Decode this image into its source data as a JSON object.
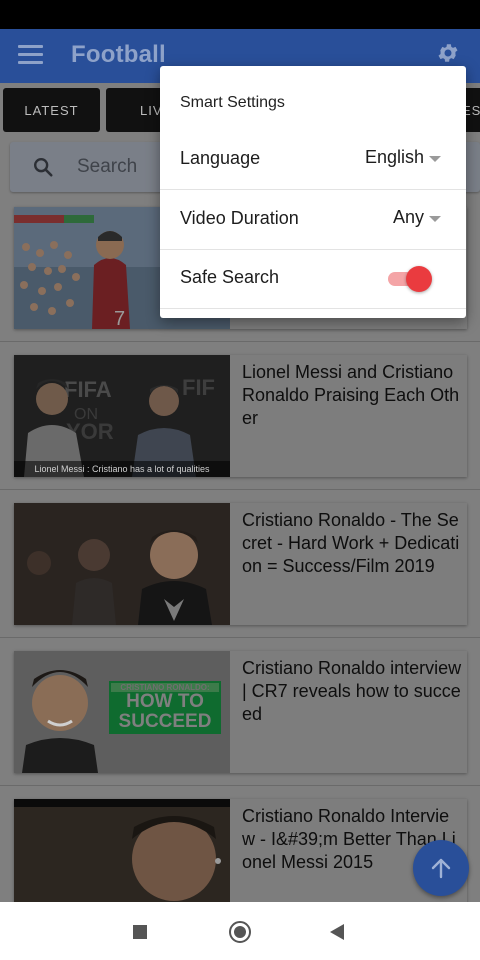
{
  "app_bar": {
    "title": "Football"
  },
  "tabs": [
    {
      "label": "LATEST"
    },
    {
      "label": "LIV"
    },
    {
      "label": "ES"
    }
  ],
  "search": {
    "placeholder": "Search"
  },
  "videos": [
    {
      "title": ""
    },
    {
      "title": "Lionel Messi and Cristiano Ronaldo Praising Each Other",
      "thumb_caption": "Lionel Messi : Cristiano has a lot of qualities"
    },
    {
      "title": "Cristiano Ronaldo - The Secret - Hard Work + Dedication = Success/Film 2019"
    },
    {
      "title": "Cristiano Ronaldo interview | CR7 reveals how to succeed",
      "badge_small": "CRISTIANO RONALDO:",
      "badge_line1": "HOW TO",
      "badge_line2": "SUCCEED"
    },
    {
      "title": "Cristiano Ronaldo Interview - I&#39;m Better Than Lionel Messi 2015"
    }
  ],
  "settings_popup": {
    "title": "Smart Settings",
    "language": {
      "label": "Language",
      "value": "English"
    },
    "duration": {
      "label": "Video Duration",
      "value": "Any"
    },
    "safe_search": {
      "label": "Safe Search",
      "enabled": true
    }
  },
  "colors": {
    "primary": "#2962ff",
    "accent": "#f44336",
    "toggle_track": "#f7a3a4"
  }
}
